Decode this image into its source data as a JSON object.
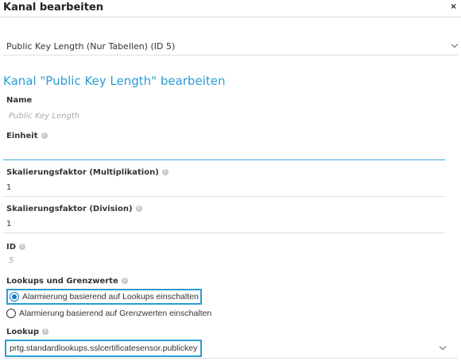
{
  "dialog": {
    "title": "Kanal bearbeiten",
    "close_label": "×"
  },
  "channel_select": {
    "value": "Public Key Length (Nur Tabellen) (ID 5)"
  },
  "section": {
    "title": "Kanal \"Public Key Length\" bearbeiten"
  },
  "fields": {
    "name": {
      "label": "Name",
      "value": "Public Key Length"
    },
    "unit": {
      "label": "Einheit",
      "value": ""
    },
    "scale_mult": {
      "label": "Skalierungsfaktor (Multiplikation)",
      "value": "1"
    },
    "scale_div": {
      "label": "Skalierungsfaktor (Division)",
      "value": "1"
    },
    "id": {
      "label": "ID",
      "value": "5"
    }
  },
  "lookups_limits": {
    "label": "Lookups und Grenzwerte",
    "options": [
      {
        "label": "Alarmierung basierend auf Lookups einschalten",
        "checked": true
      },
      {
        "label": "Alarmierung basierend auf Grenzwerten einschalten",
        "checked": false
      }
    ]
  },
  "lookup": {
    "label": "Lookup",
    "value": "prtg.standardlookups.sslcertificatesensor.publickey"
  },
  "info_icon_glyph": "i",
  "colors": {
    "accent": "#2a9dd6",
    "radio_checked": "#1a7fbf"
  }
}
